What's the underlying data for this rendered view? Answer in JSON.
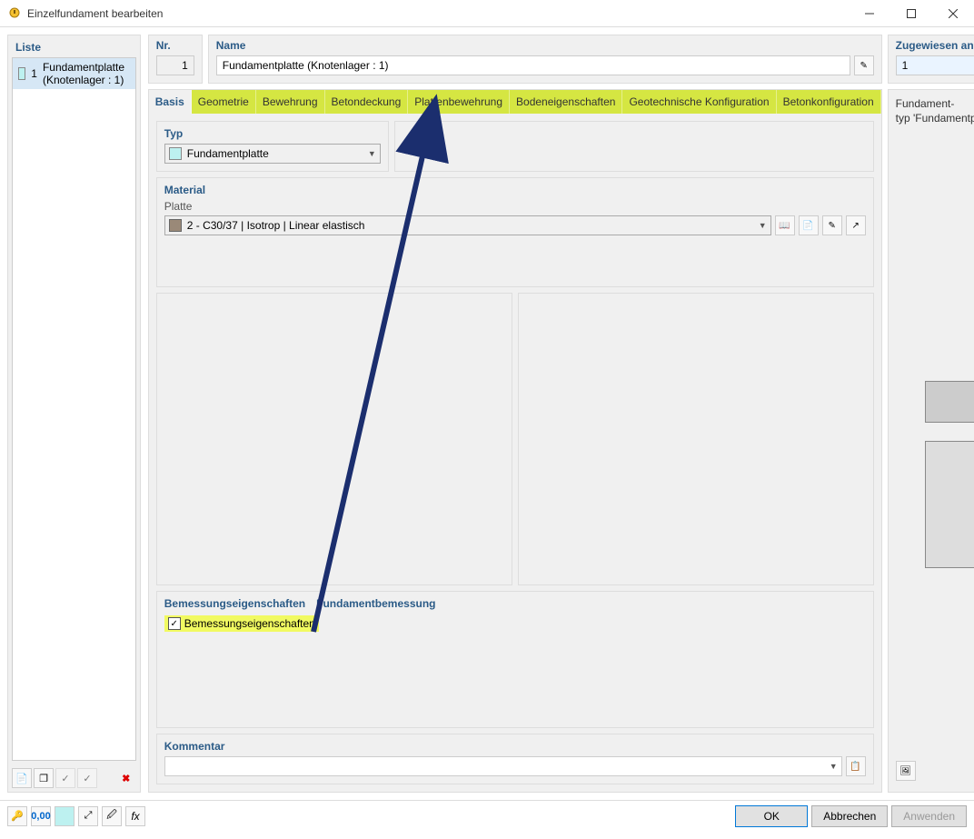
{
  "window": {
    "title": "Einzelfundament bearbeiten"
  },
  "left": {
    "label": "Liste",
    "items": [
      {
        "num": "1",
        "text": "Fundamentplatte (Knotenlager : 1)"
      }
    ]
  },
  "header": {
    "nr_label": "Nr.",
    "nr_value": "1",
    "name_label": "Name",
    "name_value": "Fundamentplatte (Knotenlager : 1)",
    "assigned_label": "Zugewiesen an Knotenlager Nr.",
    "assigned_value": "1"
  },
  "tabs": [
    "Basis",
    "Geometrie",
    "Bewehrung",
    "Betondeckung",
    "Plattenbewehrung",
    "Bodeneigenschaften",
    "Geotechnische Konfiguration",
    "Betonkonfiguration"
  ],
  "type": {
    "label": "Typ",
    "value": "Fundamentplatte"
  },
  "material": {
    "label": "Material",
    "sublabel": "Platte",
    "value": "2 - C30/37 | Isotrop | Linear elastisch"
  },
  "design": {
    "heading1": "Bemessungseigenschaften",
    "heading2": "Fundamentbemessung",
    "checkbox_label": "Bemessungseigenschaften",
    "checked": true
  },
  "comment": {
    "label": "Kommentar",
    "value": ""
  },
  "preview": {
    "line1": "Fundament-",
    "line2": "typ 'Fundamentplatte'"
  },
  "footer": {
    "ok": "OK",
    "cancel": "Abbrechen",
    "apply": "Anwenden"
  }
}
